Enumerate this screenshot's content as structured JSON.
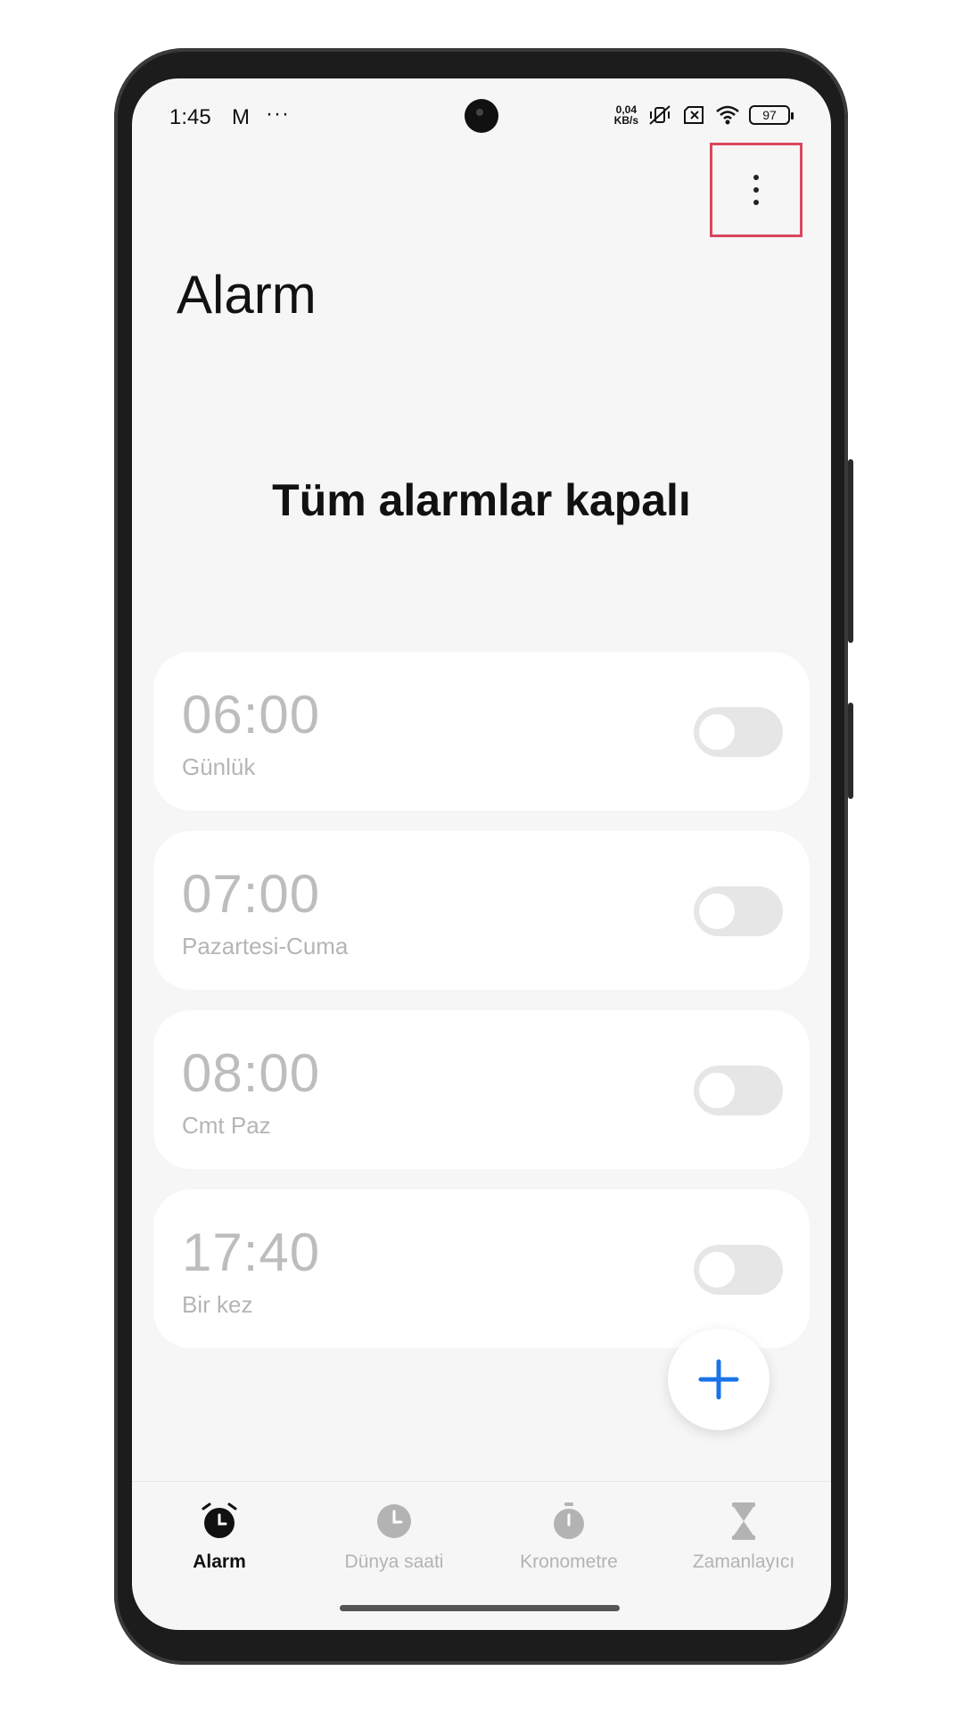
{
  "status_bar": {
    "time": "1:45",
    "notif_icon": "M",
    "more": "···",
    "speed_top": "0,04",
    "speed_bottom": "KB/s",
    "battery": "97"
  },
  "header": {
    "title": "Alarm",
    "menu_icon": "more-vert-icon"
  },
  "empty_message": "Tüm alarmlar kapalı",
  "alarms": [
    {
      "time": "06:00",
      "repeat": "Günlük",
      "enabled": false
    },
    {
      "time": "07:00",
      "repeat": "Pazartesi-Cuma",
      "enabled": false
    },
    {
      "time": "08:00",
      "repeat": "Cmt Paz",
      "enabled": false
    },
    {
      "time": "17:40",
      "repeat": "Bir kez",
      "enabled": false
    }
  ],
  "fab": {
    "icon": "plus-icon",
    "color": "#1a73e8"
  },
  "nav": [
    {
      "label": "Alarm",
      "icon": "alarm-clock-icon",
      "active": true
    },
    {
      "label": "Dünya saati",
      "icon": "clock-icon",
      "active": false
    },
    {
      "label": "Kronometre",
      "icon": "stopwatch-icon",
      "active": false
    },
    {
      "label": "Zamanlayıcı",
      "icon": "hourglass-icon",
      "active": false
    }
  ],
  "colors": {
    "highlight": "#d9475d",
    "accent": "#1a73e8"
  }
}
